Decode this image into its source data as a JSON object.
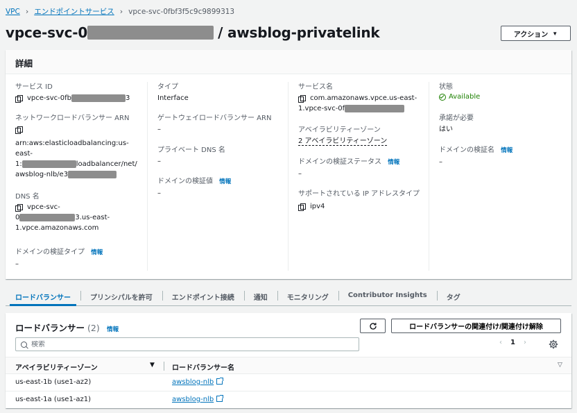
{
  "breadcrumb": {
    "items": [
      "VPC",
      "エンドポイントサービス"
    ],
    "current": "vpce-svc-0fbf3f5c9c9899313"
  },
  "header": {
    "title_prefix": "vpce-svc-0",
    "title_suffix": "/ awsblog-privatelink",
    "actions_label": "アクション"
  },
  "details": {
    "heading": "詳細",
    "info_label": "情報",
    "service_id": {
      "label": "サービス ID",
      "value_prefix": "vpce-svc-0fb",
      "value_suffix": "3"
    },
    "nlb_arn": {
      "label": "ネットワークロードバランサー ARN",
      "line1": "arn:aws:elasticloadbalancing:us-",
      "line2": "east-",
      "line3_prefix": "1:",
      "line3_suffix": "loadbalancer/net/",
      "line4_prefix": "awsblog-nlb/e3"
    },
    "dns_name": {
      "label": "DNS 名",
      "line1": "vpce-svc-",
      "line2_prefix": "0",
      "line2_suffix": "3.us-east-",
      "line3": "1.vpce.amazonaws.com"
    },
    "domain_verification_type": {
      "label": "ドメインの検証タイプ",
      "value": "–"
    },
    "type": {
      "label": "タイプ",
      "value": "Interface"
    },
    "gwlb_arn": {
      "label": "ゲートウェイロードバランサー ARN",
      "value": "–"
    },
    "private_dns": {
      "label": "プライベート DNS 名",
      "value": "–"
    },
    "domain_verification_value": {
      "label": "ドメインの検証値",
      "value": "–"
    },
    "service_name": {
      "label": "サービス名",
      "line1": "com.amazonaws.vpce.us-east-",
      "line2_prefix": "1.vpce-svc-0f"
    },
    "availability_zones": {
      "label": "アベイラビリティーゾーン",
      "value": "2 アベイラビリティーゾーン"
    },
    "domain_verification_status": {
      "label": "ドメインの検証ステータス",
      "value": "–"
    },
    "supported_ip": {
      "label": "サポートされている IP アドレスタイプ",
      "value": "ipv4"
    },
    "state": {
      "label": "状態",
      "value": "Available"
    },
    "acceptance_required": {
      "label": "承諾が必要",
      "value": "はい"
    },
    "domain_verification_name": {
      "label": "ドメインの検証名",
      "value": "–"
    }
  },
  "tabs": [
    "ロードバランサー",
    "プリンシパルを許可",
    "エンドポイント接続",
    "通知",
    "モニタリング",
    "Contributor Insights",
    "タグ"
  ],
  "load_balancers": {
    "title": "ロードバランサー",
    "count": "(2)",
    "info_label": "情報",
    "associate_button": "ロードバランサーの関連付け/関連付け解除",
    "search_placeholder": "検索",
    "page": "1",
    "columns": [
      "アベイラビリティーゾーン",
      "ロードバランサー名"
    ],
    "rows": [
      {
        "az": "us-east-1b (use1-az2)",
        "name": "awsblog-nlb"
      },
      {
        "az": "us-east-1a (use1-az1)",
        "name": "awsblog-nlb"
      }
    ]
  },
  "colors": {
    "link": "#0073bb",
    "available": "#1d8102",
    "text": "#16191f",
    "muted": "#545b64"
  }
}
